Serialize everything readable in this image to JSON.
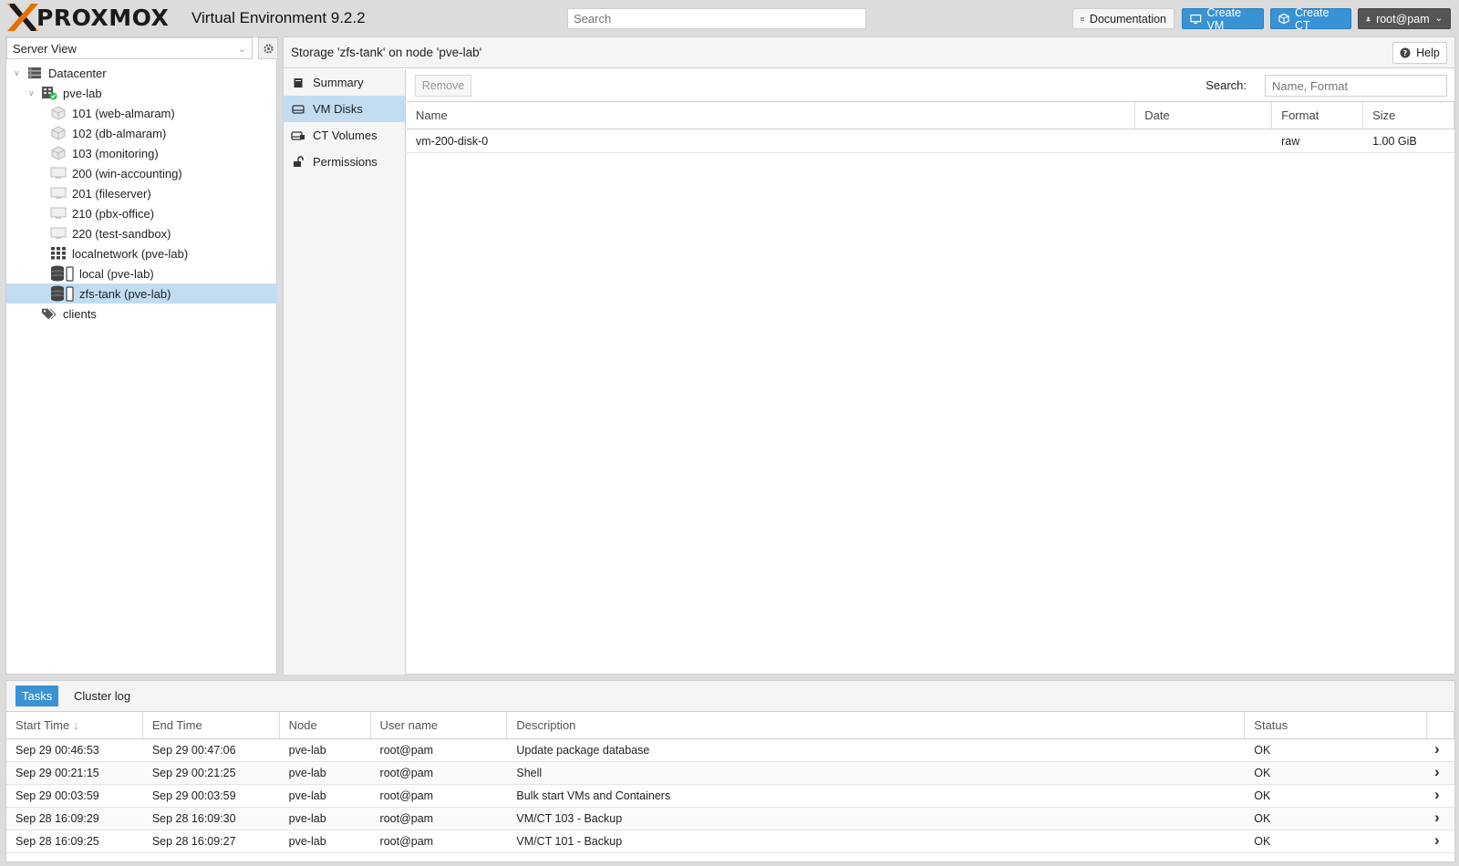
{
  "header": {
    "logo_text": "PROXMOX",
    "app_title": "Virtual Environment 9.2.2",
    "search_placeholder": "Search",
    "doc_label": "Documentation",
    "create_vm_label": "Create VM",
    "create_ct_label": "Create CT",
    "user_label": "root@pam"
  },
  "sidebar": {
    "view_label": "Server View",
    "tree": [
      {
        "label": "Datacenter",
        "icon": "datacenter-icon",
        "indent": 0
      },
      {
        "label": "pve-lab",
        "icon": "node-icon",
        "indent": 1
      },
      {
        "label": "101 (web-almaram)",
        "icon": "container-icon",
        "indent": 2
      },
      {
        "label": "102 (db-almaram)",
        "icon": "container-icon",
        "indent": 2
      },
      {
        "label": "103 (monitoring)",
        "icon": "container-icon",
        "indent": 2
      },
      {
        "label": "200 (win-accounting)",
        "icon": "vm-icon",
        "indent": 2
      },
      {
        "label": "201 (fileserver)",
        "icon": "vm-icon",
        "indent": 2
      },
      {
        "label": "210 (pbx-office)",
        "icon": "vm-icon",
        "indent": 2
      },
      {
        "label": "220 (test-sandbox)",
        "icon": "vm-icon",
        "indent": 2
      },
      {
        "label": "localnetwork (pve-lab)",
        "icon": "network-grid-icon",
        "indent": 2
      },
      {
        "label": "local (pve-lab)",
        "icon": "storage-icon",
        "indent": 2
      },
      {
        "label": "zfs-tank (pve-lab)",
        "icon": "storage-icon",
        "indent": 2,
        "selected": true
      },
      {
        "label": "clients",
        "icon": "tags-icon",
        "indent": 1
      }
    ]
  },
  "content": {
    "title": "Storage 'zfs-tank' on node 'pve-lab'",
    "help_label": "Help",
    "subnav": [
      {
        "label": "Summary",
        "icon": "book-icon"
      },
      {
        "label": "VM Disks",
        "icon": "hdd-icon",
        "active": true
      },
      {
        "label": "CT Volumes",
        "icon": "ct-volume-icon"
      },
      {
        "label": "Permissions",
        "icon": "unlock-icon"
      }
    ],
    "toolbar": {
      "remove_label": "Remove",
      "search_label": "Search:",
      "search_placeholder": "Name, Format"
    },
    "columns": [
      "Name",
      "Date",
      "Format",
      "Size"
    ],
    "rows": [
      {
        "name": "vm-200-disk-0",
        "date": "",
        "format": "raw",
        "size": "1.00 GiB"
      }
    ]
  },
  "tasks": {
    "tabs": [
      "Tasks",
      "Cluster log"
    ],
    "columns": [
      "Start Time",
      "End Time",
      "Node",
      "User name",
      "Description",
      "Status"
    ],
    "rows": [
      {
        "start": "Sep 29 00:46:53",
        "end": "Sep 29 00:47:06",
        "node": "pve-lab",
        "user": "root@pam",
        "desc": "Update package database",
        "status": "OK"
      },
      {
        "start": "Sep 29 00:21:15",
        "end": "Sep 29 00:21:25",
        "node": "pve-lab",
        "user": "root@pam",
        "desc": "Shell",
        "status": "OK"
      },
      {
        "start": "Sep 29 00:03:59",
        "end": "Sep 29 00:03:59",
        "node": "pve-lab",
        "user": "root@pam",
        "desc": "Bulk start VMs and Containers",
        "status": "OK"
      },
      {
        "start": "Sep 28 16:09:29",
        "end": "Sep 28 16:09:30",
        "node": "pve-lab",
        "user": "root@pam",
        "desc": "VM/CT 103 - Backup",
        "status": "OK"
      },
      {
        "start": "Sep 28 16:09:25",
        "end": "Sep 28 16:09:27",
        "node": "pve-lab",
        "user": "root@pam",
        "desc": "VM/CT 101 - Backup",
        "status": "OK"
      }
    ]
  },
  "colors": {
    "accent": "#3892d4",
    "selection": "#c2ddf2",
    "logo_orange": "#e57000"
  }
}
